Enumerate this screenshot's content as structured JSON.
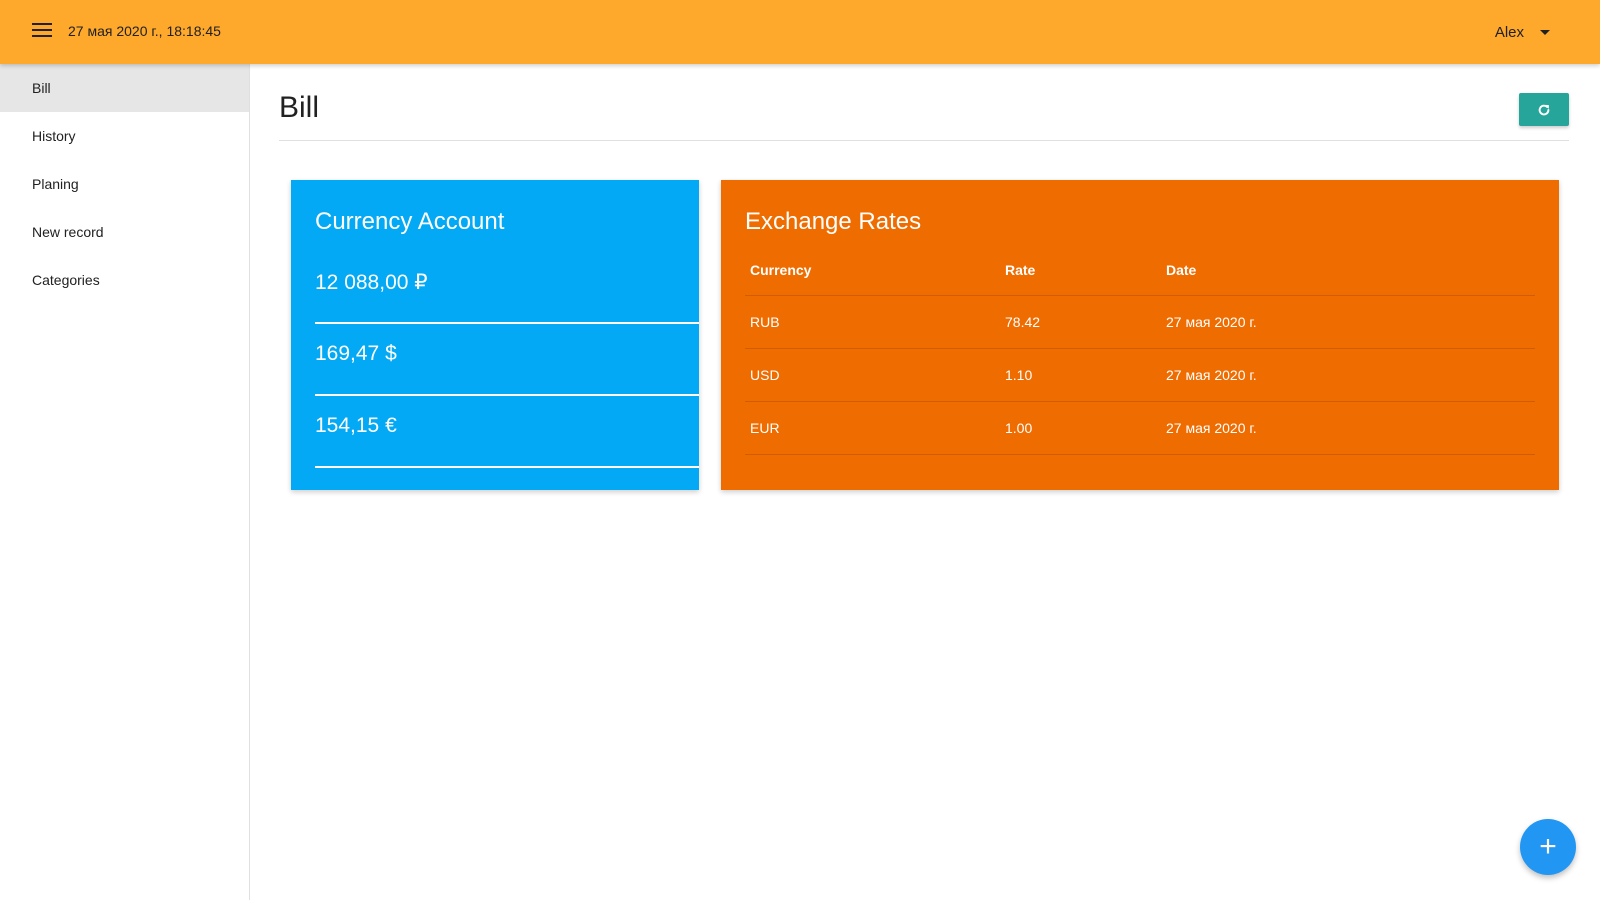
{
  "navbar": {
    "datetime": "27 мая 2020 г., 18:18:45",
    "user": "Alex",
    "menu_icon": "hamburger-menu-icon",
    "caret_icon": "caret-down-icon"
  },
  "sidebar": {
    "items": [
      {
        "label": "Bill",
        "active": true
      },
      {
        "label": "History"
      },
      {
        "label": "Planing"
      },
      {
        "label": "New record"
      },
      {
        "label": "Categories"
      }
    ]
  },
  "page": {
    "title": "Bill",
    "refresh_icon": "refresh-icon"
  },
  "currency_card": {
    "title": "Currency Account",
    "accounts": [
      "12 088,00 ₽",
      "169,47 $",
      "154,15 €"
    ]
  },
  "rates_card": {
    "title": "Exchange Rates",
    "headers": [
      "Currency",
      "Rate",
      "Date"
    ],
    "rows": [
      [
        "RUB",
        "78.42",
        "27 мая 2020 г."
      ],
      [
        "USD",
        "1.10",
        "27 мая 2020 г."
      ],
      [
        "EUR",
        "1.00",
        "27 мая 2020 г."
      ]
    ]
  },
  "fab": {
    "label": "+",
    "icon": "plus-icon"
  },
  "colors": {
    "navbar": "#ffa92c",
    "currency_card": "#03a9f4",
    "rates_card": "#ef6c00",
    "refresh_button": "#26a69a",
    "fab": "#2196f3"
  }
}
